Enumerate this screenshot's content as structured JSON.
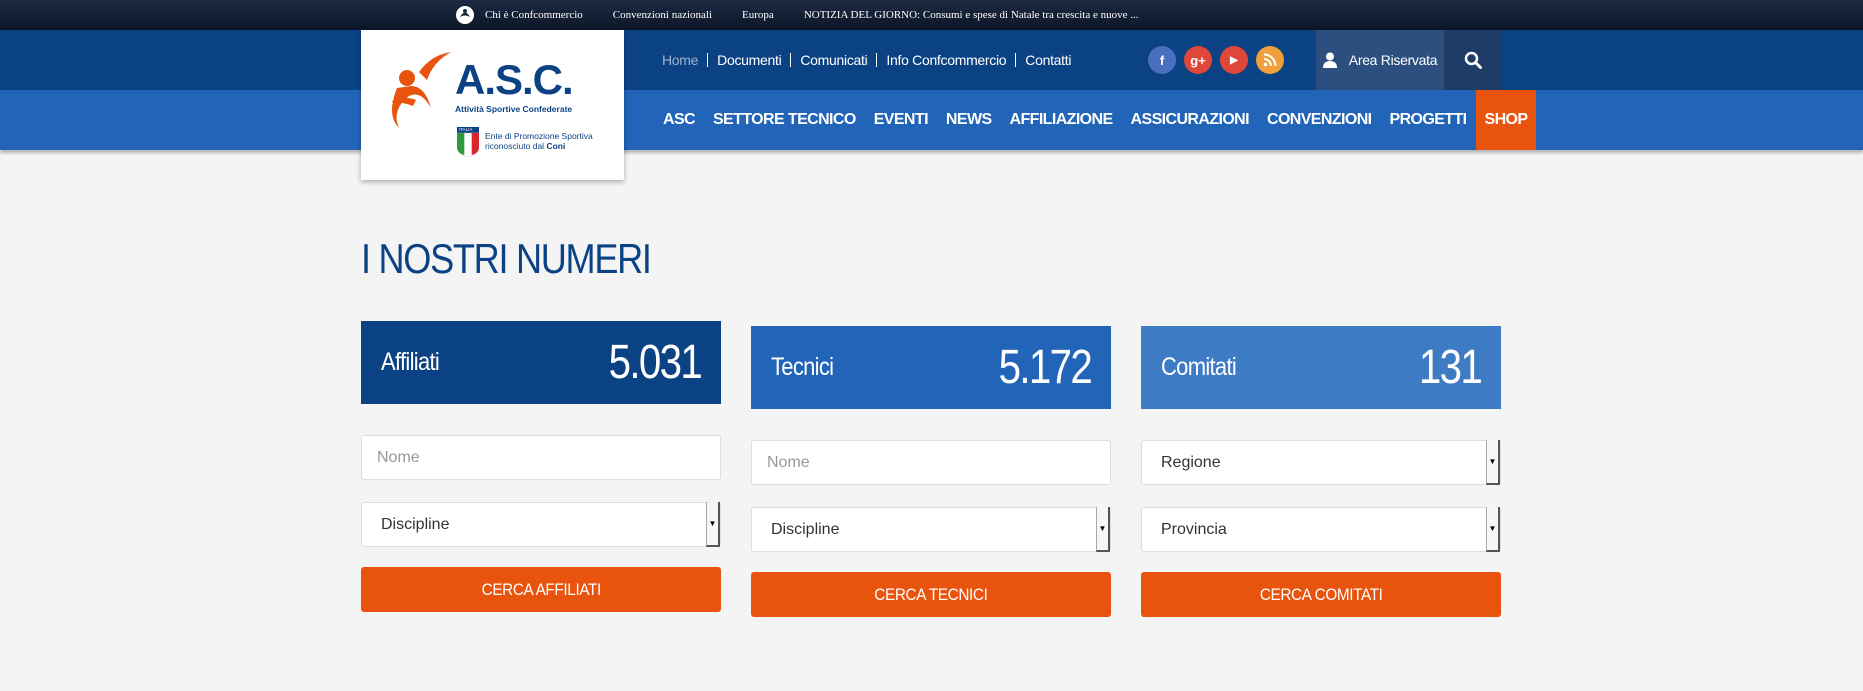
{
  "topbar": {
    "links": [
      "Chi è Confcommercio",
      "Convenzioni nazionali",
      "Europa",
      "NOTIZIA DEL GIORNO: Consumi e spese di Natale tra crescita e nuove ..."
    ]
  },
  "logo": {
    "brand": "A.S.C.",
    "tagline": "Attività Sportive Confederate",
    "badge": "ITALIA",
    "sub1": "Ente di Promozione Sportiva",
    "sub2": "riconosciuto dal",
    "sub3": "Coni"
  },
  "utility_links": [
    "Home",
    "Documenti",
    "Comunicati",
    "Info Confcommercio",
    "Contatti"
  ],
  "social": [
    {
      "icon": "facebook-icon",
      "glyph": "f",
      "color": "#4a6fbf"
    },
    {
      "icon": "google-plus-icon",
      "glyph": "g+",
      "color": "#e0463a"
    },
    {
      "icon": "youtube-icon",
      "glyph": "▶",
      "color": "#e0463a"
    },
    {
      "icon": "rss-icon",
      "glyph": ")",
      "color": "#f0a03a"
    }
  ],
  "area_riservata": "Area Riservata",
  "menu": [
    "ASC",
    "SETTORE TECNICO",
    "EVENTI",
    "NEWS",
    "AFFILIAZIONE",
    "ASSICURAZIONI",
    "CONVENZIONI",
    "PROGETTI",
    "SHOP"
  ],
  "page_title": "I NOSTRI NUMERI",
  "columns": [
    {
      "label": "Affiliati",
      "value": "5.031",
      "color": "#0b4283",
      "fields": [
        {
          "type": "input",
          "placeholder": "Nome"
        },
        {
          "type": "select",
          "value": "Discipline"
        }
      ],
      "button": "CERCA AFFILIATI"
    },
    {
      "label": "Tecnici",
      "value": "5.172",
      "color": "#2164b8",
      "fields": [
        {
          "type": "input",
          "placeholder": "Nome"
        },
        {
          "type": "select",
          "value": "Discipline"
        }
      ],
      "button": "CERCA TECNICI"
    },
    {
      "label": "Comitati",
      "value": "131",
      "color": "#3d7bc4",
      "fields": [
        {
          "type": "select",
          "value": "Regione"
        },
        {
          "type": "select",
          "value": "Provincia"
        }
      ],
      "button": "CERCA COMITATI"
    }
  ],
  "colors": {
    "accent": "#e8540e",
    "dark_blue": "#0b4283",
    "mid_blue": "#2164b8"
  }
}
